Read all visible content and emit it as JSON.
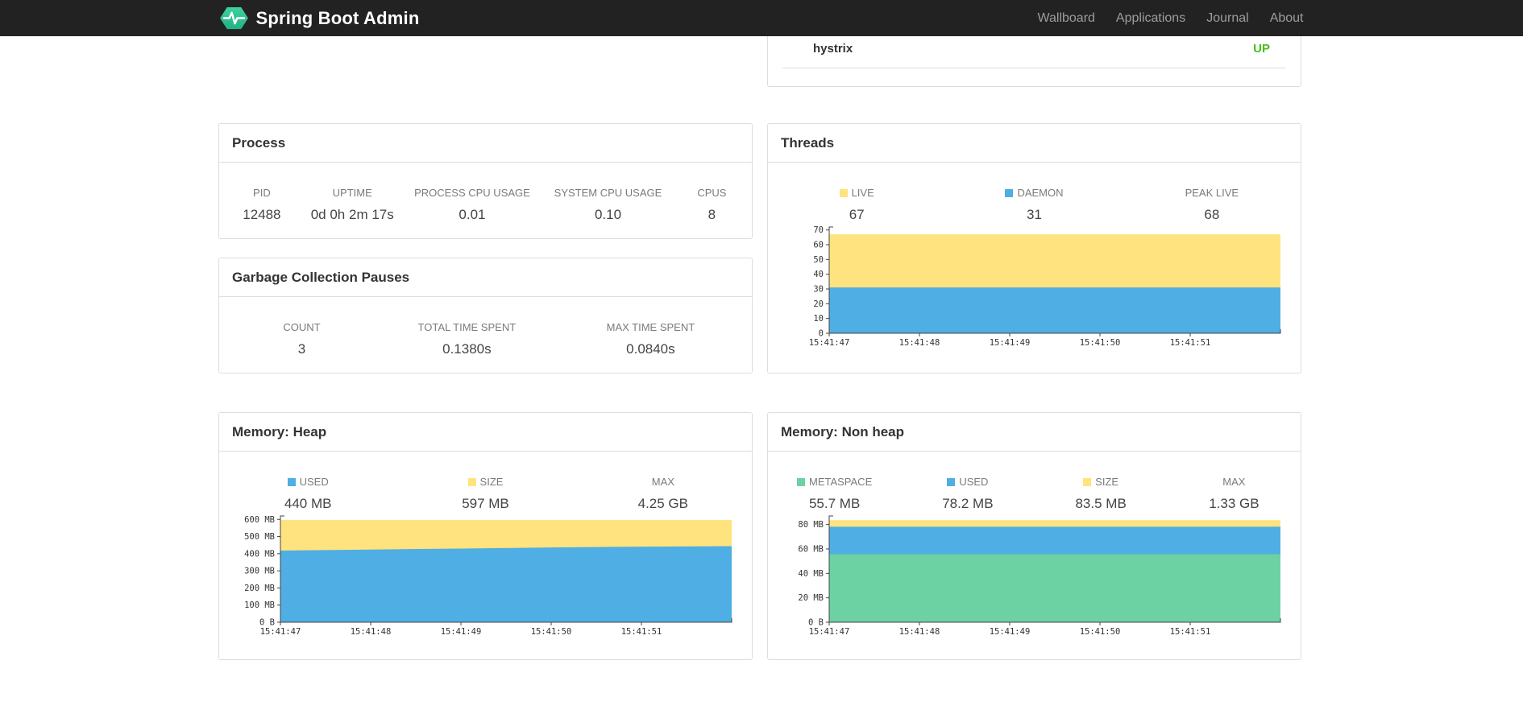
{
  "navbar": {
    "brand": "Spring Boot Admin",
    "items": [
      {
        "label": "Wallboard"
      },
      {
        "label": "Applications"
      },
      {
        "label": "Journal"
      },
      {
        "label": "About"
      }
    ]
  },
  "health": {
    "rows": [
      {
        "name": "hystrix",
        "status": "UP"
      }
    ]
  },
  "colors": {
    "status_up": "#46c018",
    "series_blue": "#4faee3",
    "series_yellow": "#ffe37e",
    "series_green": "#6cd1a3"
  },
  "panels": {
    "process": {
      "title": "Process",
      "metrics": [
        {
          "label": "PID",
          "value": "12488"
        },
        {
          "label": "UPTIME",
          "value": "0d 0h 2m 17s"
        },
        {
          "label": "PROCESS CPU USAGE",
          "value": "0.01"
        },
        {
          "label": "SYSTEM CPU USAGE",
          "value": "0.10"
        },
        {
          "label": "CPUS",
          "value": "8"
        }
      ]
    },
    "gc": {
      "title": "Garbage Collection Pauses",
      "metrics": [
        {
          "label": "COUNT",
          "value": "3"
        },
        {
          "label": "TOTAL TIME SPENT",
          "value": "0.1380s"
        },
        {
          "label": "MAX TIME SPENT",
          "value": "0.0840s"
        }
      ]
    },
    "threads": {
      "title": "Threads",
      "metrics": [
        {
          "label": "LIVE",
          "value": "67",
          "color": "#ffe37e"
        },
        {
          "label": "DAEMON",
          "value": "31",
          "color": "#4faee3"
        },
        {
          "label": "PEAK LIVE",
          "value": "68"
        }
      ]
    },
    "heap": {
      "title": "Memory: Heap",
      "metrics": [
        {
          "label": "USED",
          "value": "440 MB",
          "color": "#4faee3"
        },
        {
          "label": "SIZE",
          "value": "597 MB",
          "color": "#ffe37e"
        },
        {
          "label": "MAX",
          "value": "4.25 GB"
        }
      ]
    },
    "nonheap": {
      "title": "Memory: Non heap",
      "metrics": [
        {
          "label": "METASPACE",
          "value": "55.7 MB",
          "color": "#6cd1a3"
        },
        {
          "label": "USED",
          "value": "78.2 MB",
          "color": "#4faee3"
        },
        {
          "label": "SIZE",
          "value": "83.5 MB",
          "color": "#ffe37e"
        },
        {
          "label": "MAX",
          "value": "1.33 GB"
        }
      ]
    }
  },
  "chart_data": [
    {
      "id": "threads",
      "type": "area",
      "title": "Threads",
      "x": [
        "15:41:47",
        "15:41:48",
        "15:41:49",
        "15:41:50",
        "15:41:51",
        ""
      ],
      "ylim": [
        0,
        72
      ],
      "yticks": [
        {
          "v": 0,
          "label": "0"
        },
        {
          "v": 10,
          "label": "10"
        },
        {
          "v": 20,
          "label": "20"
        },
        {
          "v": 30,
          "label": "30"
        },
        {
          "v": 40,
          "label": "40"
        },
        {
          "v": 50,
          "label": "50"
        },
        {
          "v": 60,
          "label": "60"
        },
        {
          "v": 70,
          "label": "70"
        }
      ],
      "series": [
        {
          "name": "LIVE",
          "color": "#ffe37e",
          "values": [
            67,
            67,
            67,
            67,
            67,
            67
          ]
        },
        {
          "name": "DAEMON",
          "color": "#4faee3",
          "values": [
            31,
            31,
            31,
            31,
            31,
            31
          ]
        }
      ],
      "legend_position": "top"
    },
    {
      "id": "heap",
      "type": "area",
      "title": "Memory: Heap (MB)",
      "x": [
        "15:41:47",
        "15:41:48",
        "15:41:49",
        "15:41:50",
        "15:41:51",
        ""
      ],
      "ylim": [
        0,
        620
      ],
      "yticks": [
        {
          "v": 0,
          "label": "0 B"
        },
        {
          "v": 100,
          "label": "100 MB"
        },
        {
          "v": 200,
          "label": "200 MB"
        },
        {
          "v": 300,
          "label": "300 MB"
        },
        {
          "v": 400,
          "label": "400 MB"
        },
        {
          "v": 500,
          "label": "500 MB"
        },
        {
          "v": 600,
          "label": "600 MB"
        }
      ],
      "series": [
        {
          "name": "SIZE",
          "color": "#ffe37e",
          "values": [
            597,
            597,
            597,
            597,
            597,
            597
          ]
        },
        {
          "name": "USED",
          "color": "#4faee3",
          "values": [
            418,
            424,
            430,
            436,
            441,
            444
          ]
        }
      ],
      "legend_position": "top"
    },
    {
      "id": "nonheap",
      "type": "area",
      "title": "Memory: Non heap (MB)",
      "x": [
        "15:41:47",
        "15:41:48",
        "15:41:49",
        "15:41:50",
        "15:41:51",
        ""
      ],
      "ylim": [
        0,
        87
      ],
      "yticks": [
        {
          "v": 0,
          "label": "0 B"
        },
        {
          "v": 20,
          "label": "20 MB"
        },
        {
          "v": 40,
          "label": "40 MB"
        },
        {
          "v": 60,
          "label": "60 MB"
        },
        {
          "v": 80,
          "label": "80 MB"
        }
      ],
      "series": [
        {
          "name": "SIZE",
          "color": "#ffe37e",
          "values": [
            83.5,
            83.5,
            83.5,
            83.5,
            83.5,
            83.5
          ]
        },
        {
          "name": "USED",
          "color": "#4faee3",
          "values": [
            78.2,
            78.2,
            78.2,
            78.2,
            78.2,
            78.2
          ]
        },
        {
          "name": "METASPACE",
          "color": "#6cd1a3",
          "values": [
            55.7,
            55.7,
            55.7,
            55.7,
            55.7,
            55.7
          ]
        }
      ],
      "legend_position": "top"
    }
  ]
}
